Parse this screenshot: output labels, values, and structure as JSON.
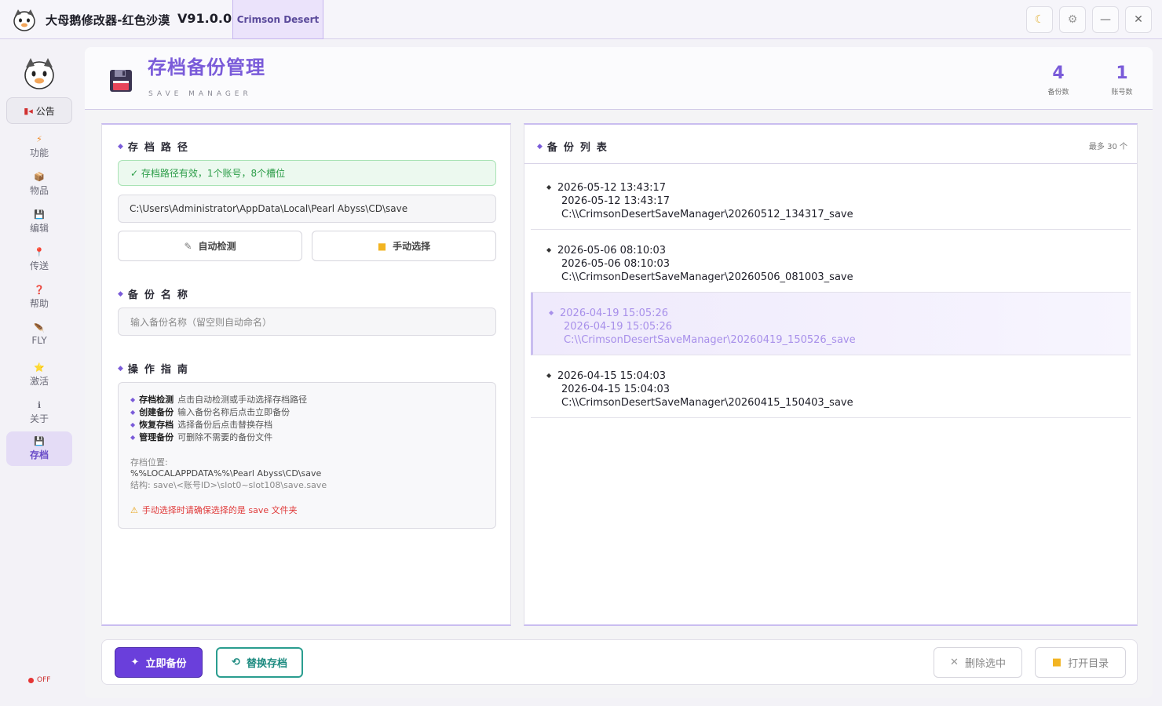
{
  "titlebar": {
    "app_title": "大母鹅修改器-红色沙漠",
    "version": "V91.0.0",
    "game_tab": "Crimson Desert",
    "theme_icon": "moon-icon",
    "settings_icon": "gear-icon",
    "minimize_label": "—",
    "close_label": "✕"
  },
  "sidebar": {
    "notice_label": "公告",
    "items": [
      {
        "label": "功能",
        "icon": "⚡"
      },
      {
        "label": "物品",
        "icon": "📦"
      },
      {
        "label": "编辑",
        "icon": "💾"
      },
      {
        "label": "传送",
        "icon": "📍"
      },
      {
        "label": "帮助",
        "icon": "❓"
      },
      {
        "label": "FLY",
        "icon": "🪶"
      },
      {
        "label": "激活",
        "icon": "⭐"
      },
      {
        "label": "关于",
        "icon": "ℹ"
      },
      {
        "label": "存档",
        "icon": "💾"
      }
    ],
    "status": "OFF"
  },
  "header": {
    "title": "存档备份管理",
    "subtitle": "SAVE MANAGER",
    "stats": [
      {
        "value": "4",
        "label": "备份数"
      },
      {
        "value": "1",
        "label": "账号数"
      }
    ]
  },
  "left": {
    "path_section": "存档路径",
    "path_status": "✓ 存档路径有效，1个账号，8个槽位",
    "path_value": "C:\\Users\\Administrator\\AppData\\Local\\Pearl Abyss\\CD\\save",
    "auto_detect": "自动检测",
    "manual_select": "手动选择",
    "name_section": "备份名称",
    "name_placeholder": "输入备份名称（留空则自动命名）",
    "guide_section": "操作指南",
    "guide_items": [
      {
        "bold": "存档检测",
        "text": "点击自动检测或手动选择存档路径"
      },
      {
        "bold": "创建备份",
        "text": "输入备份名称后点击立即备份"
      },
      {
        "bold": "恢复存档",
        "text": "选择备份后点击替换存档"
      },
      {
        "bold": "管理备份",
        "text": "可删除不需要的备份文件"
      }
    ],
    "location_label": "存档位置:",
    "location_value": "%%LOCALAPPDATA%%\\Pearl Abyss\\CD\\save",
    "structure": "结构: save\\<账号ID>\\slot0~slot108\\save.save",
    "warning": "手动选择时请确保选择的是 save 文件夹"
  },
  "right": {
    "list_title": "备份列表",
    "limit": "最多 30 个",
    "backups": [
      {
        "title": "2026-05-12 13:43:17",
        "time": "2026-05-12 13:43:17",
        "path": "C:\\\\CrimsonDesertSaveManager\\20260512_134317_save"
      },
      {
        "title": "2026-05-06 08:10:03",
        "time": "2026-05-06 08:10:03",
        "path": "C:\\\\CrimsonDesertSaveManager\\20260506_081003_save"
      },
      {
        "title": "2026-04-19 15:05:26",
        "time": "2026-04-19 15:05:26",
        "path": "C:\\\\CrimsonDesertSaveManager\\20260419_150526_save"
      },
      {
        "title": "2026-04-15 15:04:03",
        "time": "2026-04-15 15:04:03",
        "path": "C:\\\\CrimsonDesertSaveManager\\20260415_150403_save"
      }
    ]
  },
  "bottom": {
    "backup_now": "立即备份",
    "replace_save": "替换存档",
    "delete_selected": "删除选中",
    "open_dir": "打开目录"
  },
  "colors": {
    "accent": "#7a5bd9",
    "primary_button": "#6a3fdb",
    "teal": "#2a9d8f",
    "success": "#2c9d48",
    "warning": "#e03a3a"
  }
}
